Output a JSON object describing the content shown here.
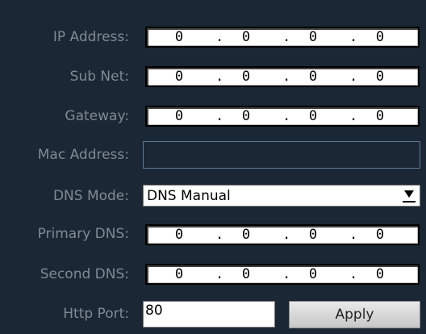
{
  "fields": {
    "ip_address": {
      "label": "IP Address:",
      "octets": [
        "0",
        "0",
        "0",
        "0"
      ]
    },
    "sub_net": {
      "label": "Sub Net:",
      "octets": [
        "0",
        "0",
        "0",
        "0"
      ]
    },
    "gateway": {
      "label": "Gateway:",
      "octets": [
        "0",
        "0",
        "0",
        "0"
      ]
    },
    "mac_address": {
      "label": "Mac Address:",
      "value": ""
    },
    "dns_mode": {
      "label": "DNS Mode:",
      "value": "DNS Manual",
      "icon": "chevron-down-icon"
    },
    "primary_dns": {
      "label": "Primary DNS:",
      "octets": [
        "0",
        "0",
        "0",
        "0"
      ]
    },
    "second_dns": {
      "label": "Second DNS:",
      "octets": [
        "0",
        "0",
        "0",
        "0"
      ]
    },
    "http_port": {
      "label": "Http Port:",
      "value": "80"
    }
  },
  "separator": ".",
  "apply_label": "Apply",
  "colors": {
    "background": "#1b2734",
    "label": "#808a95",
    "mac_border": "#5c7a95"
  }
}
